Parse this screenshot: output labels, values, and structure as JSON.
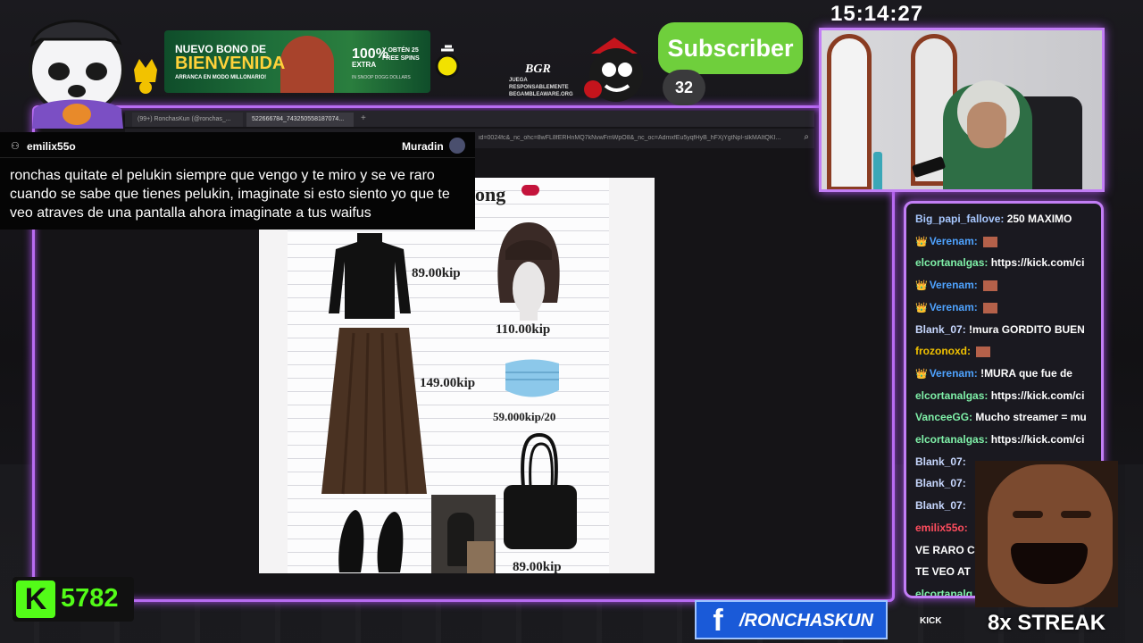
{
  "stream": {
    "clock": "15:14:27",
    "subscriber_label": "Subscriber",
    "subscriber_count": "32",
    "kick_count": "5782",
    "kick_logo": "K",
    "facebook_handle": "/RONCHASKUN",
    "streak": "8x STREAK",
    "socials_label": "KICK"
  },
  "promo": {
    "title_line1": "NUEVO BONO DE",
    "title_line2": "BIENVENIDA",
    "subtitle": "ARRANCA EN MODO MILLONARIO!",
    "percent": "100%",
    "spins": "Y OBTÉN 25 FREE SPINS",
    "extra": "EXTRA",
    "footer": "IN SNOOP DOGG DOLLARS",
    "bgr_logo": "BGR",
    "bgr_text": "JUEGA RESPONSABLEMENTE BEGAMBLEAWARE.ORG"
  },
  "browser": {
    "tab1": "(99+) RonchasKun (@ronchas_...",
    "tab2": "522666784_743250558187074...",
    "url": "id=0024fc&_nc_ohc=8wFL8fERHnMQ7kNvwFmWpO8&_nc_oc=AdmxfEu5yqfHyB_hFXjYgtNpl-slkMAItQKI...",
    "search_icon": "search-icon"
  },
  "highlight": {
    "username": "emilix55o",
    "target": "Muradin",
    "text": "ronchas quitate el pelukin siempre que vengo y te miro y se ve raro cuando se sabe que tienes pelukin, imaginate si esto siento yo que te veo atraves de una pantalla ahora imaginate a tus waifus"
  },
  "image_content": {
    "title_fragment": "ong",
    "prices": {
      "sweater": "89.00kip",
      "wig": "110.00kip",
      "skirt": "149.00kip",
      "mask": "59.000kip/20",
      "bag": "89.00kip"
    }
  },
  "chat": [
    {
      "user": "Big_papi_fallove:",
      "user_color": "#a8c8ff",
      "badges": "",
      "msg": "250 MAXIMO"
    },
    {
      "user": "Verenam:",
      "user_color": "#4fa3ff",
      "badges": "👑",
      "msg": "",
      "emote": true
    },
    {
      "user": "elcortanalgas:",
      "user_color": "#7ff0a8",
      "badges": "",
      "msg": "https://kick.com/ci"
    },
    {
      "user": "Verenam:",
      "user_color": "#4fa3ff",
      "badges": "👑",
      "msg": "",
      "emote": true
    },
    {
      "user": "Verenam:",
      "user_color": "#4fa3ff",
      "badges": "👑",
      "msg": "",
      "emote": true
    },
    {
      "user": "Blank_07:",
      "user_color": "#c8d8ff",
      "badges": "",
      "msg": "!mura GORDITO BUEN"
    },
    {
      "user": "frozonoxd:",
      "user_color": "#f2c200",
      "badges": "",
      "msg": "",
      "emote": true
    },
    {
      "user": "Verenam:",
      "user_color": "#4fa3ff",
      "badges": "👑",
      "msg": "!MURA que fue de"
    },
    {
      "user": "elcortanalgas:",
      "user_color": "#7ff0a8",
      "badges": "",
      "msg": "https://kick.com/ci"
    },
    {
      "user": "VanceeGG:",
      "user_color": "#7ff0a8",
      "badges": "",
      "msg": "Mucho streamer = mu"
    },
    {
      "user": "elcortanalgas:",
      "user_color": "#7ff0a8",
      "badges": "",
      "msg": "https://kick.com/ci"
    },
    {
      "user": "Blank_07:",
      "user_color": "#c8d8ff",
      "badges": "",
      "msg": ""
    },
    {
      "user": "Blank_07:",
      "user_color": "#c8d8ff",
      "badges": "",
      "msg": ""
    },
    {
      "user": "Blank_07:",
      "user_color": "#c8d8ff",
      "badges": "",
      "msg": ""
    },
    {
      "user": "emilix55o:",
      "user_color": "#ff4d5e",
      "badges": "",
      "msg": ""
    },
    {
      "user": "",
      "user_color": "#fff",
      "badges": "",
      "msg": "VE RARO C"
    },
    {
      "user": "",
      "user_color": "#fff",
      "badges": "",
      "msg": "TE VEO AT"
    },
    {
      "user": "elcortanalg",
      "user_color": "#7ff0a8",
      "badges": "",
      "msg": ""
    }
  ],
  "colors": {
    "neon_border": "#c27ef5",
    "kick_green": "#53fc18",
    "subscribe_green": "#6fcf3c",
    "facebook_blue": "#1a5ad8"
  }
}
